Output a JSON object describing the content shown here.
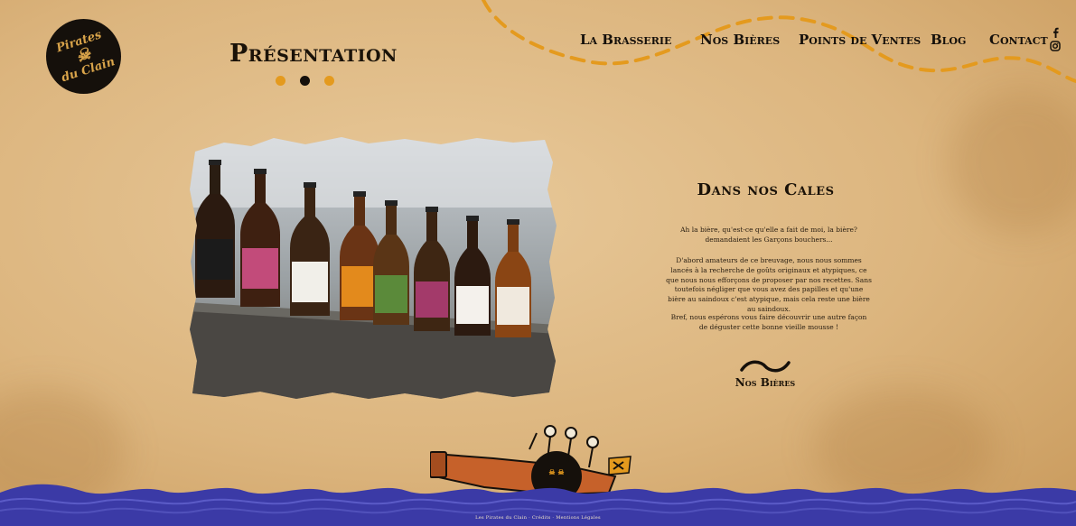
{
  "logo": {
    "text_line1": "Pirates",
    "text_line2": "du Clain"
  },
  "page": {
    "title": "Présentation"
  },
  "carousel": {
    "count": 3,
    "active": 1
  },
  "nav": {
    "items": [
      {
        "label": "La Brasserie",
        "width": 133
      },
      {
        "label": "Nos Bières",
        "width": 109
      },
      {
        "label": "Points de Ventes",
        "width": 146
      },
      {
        "label": "Blog",
        "width": 65
      },
      {
        "label": "Contact",
        "width": 60
      }
    ]
  },
  "social": {
    "facebook": "facebook-icon",
    "instagram": "instagram-icon"
  },
  "section": {
    "title": "Dans nos Cales",
    "paragraphs": [
      "Ah la bière, qu'est-ce qu'elle a fait de moi, la bière? demandaient les Garçons bouchers...",
      "D'abord amateurs de ce breuvage, nous nous sommes lancés à la recherche de goûts originaux et atypiques, ce que nous nous efforçons de proposer par nos recettes. Sans toutefois négliger que vous avez des papilles et qu'une bière au saindoux c'est atypique, mais cela reste une bière au saindoux.",
      "Bref, nous espérons vous faire découvrir une autre façon de déguster cette bonne vieille mousse !"
    ],
    "cta_label": "Nos Bières"
  },
  "footer": {
    "text": "Les Pirates du Clain · Crédits · Mentions Légales"
  },
  "colors": {
    "accent": "#e49a1e",
    "dark": "#15100b",
    "sea": "#3a3aa3",
    "paper": "#dcb57e"
  }
}
